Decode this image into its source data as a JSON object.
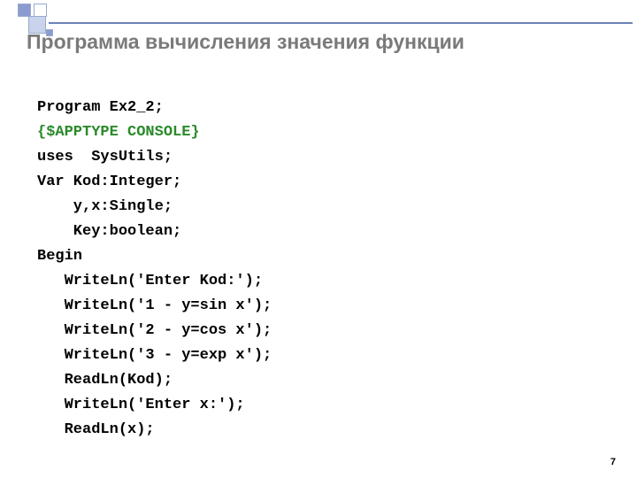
{
  "title": "Программа вычисления значения функции",
  "code": {
    "l01": "Program Ex2_2;",
    "l02": "{$APPTYPE CONSOLE}",
    "l03": "uses  SysUtils;",
    "l04": "Var Kod:Integer;",
    "l05": "    y,x:Single;",
    "l06": "    Key:boolean;",
    "l07": "Begin",
    "l08": "   WriteLn('Enter Kod:');",
    "l09": "   WriteLn('1 - y=sin x');",
    "l10": "   WriteLn('2 - y=cos x');",
    "l11": "   WriteLn('3 - y=exp x');",
    "l12": "   ReadLn(Kod);",
    "l13": "   WriteLn('Enter x:');",
    "l14": "   ReadLn(x);"
  },
  "page_number": "7"
}
